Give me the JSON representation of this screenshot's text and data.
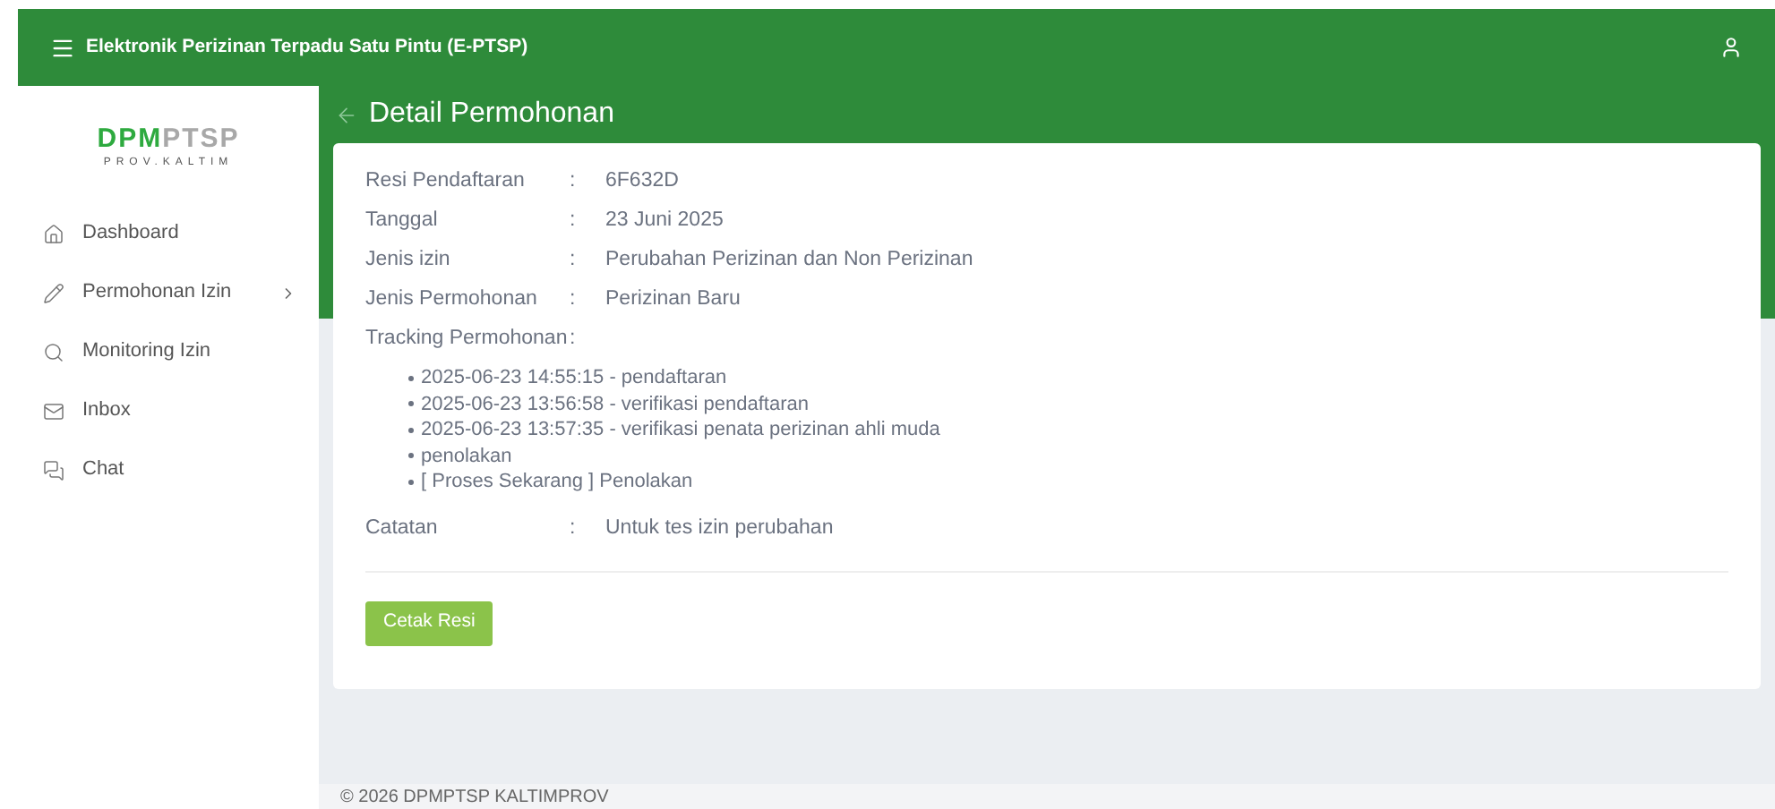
{
  "header": {
    "title": "Elektronik Perizinan Terpadu Satu Pintu (E-PTSP)"
  },
  "logo": {
    "strong": "DPM",
    "light": "PTSP",
    "subtitle": "PROV.KALTIM"
  },
  "sidebar": {
    "items": [
      {
        "label": "Dashboard",
        "expandable": false
      },
      {
        "label": "Permohonan Izin",
        "expandable": true
      },
      {
        "label": "Monitoring Izin",
        "expandable": false
      },
      {
        "label": "Inbox",
        "expandable": false
      },
      {
        "label": "Chat",
        "expandable": false
      }
    ]
  },
  "page": {
    "title": "Detail Permohonan"
  },
  "details": [
    {
      "label": "Resi Pendaftaran",
      "separator": ":",
      "value": "6F632D"
    },
    {
      "label": "Tanggal",
      "separator": ":",
      "value": "23 Juni 2025"
    },
    {
      "label": "Jenis izin",
      "separator": ":",
      "value": "Perubahan Perizinan dan Non Perizinan"
    },
    {
      "label": "Jenis Permohonan",
      "separator": ":",
      "value": "Perizinan Baru"
    },
    {
      "label": "Tracking Permohonan",
      "separator": ":"
    }
  ],
  "tracking": [
    "2025-06-23 14:55:15 - pendaftaran",
    "2025-06-23 13:56:58 - verifikasi pendaftaran",
    "2025-06-23 13:57:35 - verifikasi penata perizinan ahli muda",
    "penolakan",
    "[ Proses Sekarang ] Penolakan"
  ],
  "note": {
    "label": "Catatan",
    "separator": ":",
    "value": "Untuk tes izin perubahan"
  },
  "print_button": "Cetak Resi",
  "footer": "© 2026 DPMPTSP KALTIMPROV"
}
